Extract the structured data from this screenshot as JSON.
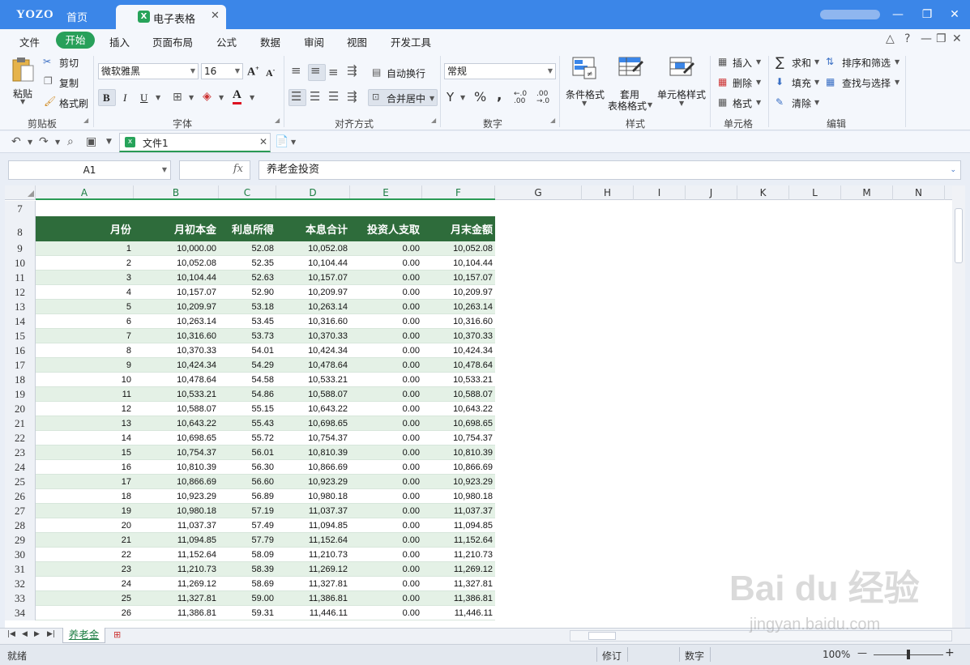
{
  "titlebar": {
    "brand": "YOZO",
    "home_tab": "首页",
    "doc_tab": "电子表格",
    "doc_tab_close": "✕",
    "minimize": "—",
    "restore": "❐",
    "close": "✕"
  },
  "menu": {
    "items": [
      "文件",
      "开始",
      "插入",
      "页面布局",
      "公式",
      "数据",
      "审阅",
      "视图",
      "开发工具"
    ],
    "active": "开始"
  },
  "ribbon": {
    "clipboard": {
      "paste": "粘贴",
      "cut": "剪切",
      "copy": "复制",
      "format_painter": "格式刷",
      "group": "剪贴板"
    },
    "font": {
      "name": "微软雅黑",
      "size": "16",
      "bold": "B",
      "italic": "I",
      "underline": "U",
      "group": "字体"
    },
    "align": {
      "wrap": "自动换行",
      "merge": "合并居中",
      "group": "对齐方式"
    },
    "number": {
      "format": "常规",
      "currency": "Y",
      "percent": "%",
      "comma": ",",
      "group": "数字"
    },
    "styles": {
      "cond": "条件格式",
      "table_1": "套用",
      "table_2": "表格格式",
      "cell_style": "单元格样式",
      "group": "样式"
    },
    "cells": {
      "insert": "插入",
      "delete": "删除",
      "format": "格式",
      "group": "单元格"
    },
    "edit": {
      "sum": "求和",
      "sort": "排序和筛选",
      "fill": "填充",
      "find": "查找与选择",
      "clear": "清除",
      "group": "编辑"
    }
  },
  "quickbar": {
    "file_tab": "文件1"
  },
  "formula_bar": {
    "name_box": "A1",
    "fx": "fx",
    "content": "养老金投资"
  },
  "columns": [
    "A",
    "B",
    "C",
    "D",
    "E",
    "F",
    "G",
    "H",
    "I",
    "J",
    "K",
    "L",
    "M",
    "N"
  ],
  "table": {
    "headers": [
      "月份",
      "月初本金",
      "利息所得",
      "本息合计",
      "投资人支取",
      "月末金额"
    ],
    "header_row": "8",
    "blank_row": "7",
    "rows": [
      [
        "9",
        "1",
        "10,000.00",
        "52.08",
        "10,052.08",
        "0.00",
        "10,052.08"
      ],
      [
        "10",
        "2",
        "10,052.08",
        "52.35",
        "10,104.44",
        "0.00",
        "10,104.44"
      ],
      [
        "11",
        "3",
        "10,104.44",
        "52.63",
        "10,157.07",
        "0.00",
        "10,157.07"
      ],
      [
        "12",
        "4",
        "10,157.07",
        "52.90",
        "10,209.97",
        "0.00",
        "10,209.97"
      ],
      [
        "13",
        "5",
        "10,209.97",
        "53.18",
        "10,263.14",
        "0.00",
        "10,263.14"
      ],
      [
        "14",
        "6",
        "10,263.14",
        "53.45",
        "10,316.60",
        "0.00",
        "10,316.60"
      ],
      [
        "15",
        "7",
        "10,316.60",
        "53.73",
        "10,370.33",
        "0.00",
        "10,370.33"
      ],
      [
        "16",
        "8",
        "10,370.33",
        "54.01",
        "10,424.34",
        "0.00",
        "10,424.34"
      ],
      [
        "17",
        "9",
        "10,424.34",
        "54.29",
        "10,478.64",
        "0.00",
        "10,478.64"
      ],
      [
        "18",
        "10",
        "10,478.64",
        "54.58",
        "10,533.21",
        "0.00",
        "10,533.21"
      ],
      [
        "19",
        "11",
        "10,533.21",
        "54.86",
        "10,588.07",
        "0.00",
        "10,588.07"
      ],
      [
        "20",
        "12",
        "10,588.07",
        "55.15",
        "10,643.22",
        "0.00",
        "10,643.22"
      ],
      [
        "21",
        "13",
        "10,643.22",
        "55.43",
        "10,698.65",
        "0.00",
        "10,698.65"
      ],
      [
        "22",
        "14",
        "10,698.65",
        "55.72",
        "10,754.37",
        "0.00",
        "10,754.37"
      ],
      [
        "23",
        "15",
        "10,754.37",
        "56.01",
        "10,810.39",
        "0.00",
        "10,810.39"
      ],
      [
        "24",
        "16",
        "10,810.39",
        "56.30",
        "10,866.69",
        "0.00",
        "10,866.69"
      ],
      [
        "25",
        "17",
        "10,866.69",
        "56.60",
        "10,923.29",
        "0.00",
        "10,923.29"
      ],
      [
        "26",
        "18",
        "10,923.29",
        "56.89",
        "10,980.18",
        "0.00",
        "10,980.18"
      ],
      [
        "27",
        "19",
        "10,980.18",
        "57.19",
        "11,037.37",
        "0.00",
        "11,037.37"
      ],
      [
        "28",
        "20",
        "11,037.37",
        "57.49",
        "11,094.85",
        "0.00",
        "11,094.85"
      ],
      [
        "29",
        "21",
        "11,094.85",
        "57.79",
        "11,152.64",
        "0.00",
        "11,152.64"
      ],
      [
        "30",
        "22",
        "11,152.64",
        "58.09",
        "11,210.73",
        "0.00",
        "11,210.73"
      ],
      [
        "31",
        "23",
        "11,210.73",
        "58.39",
        "11,269.12",
        "0.00",
        "11,269.12"
      ],
      [
        "32",
        "24",
        "11,269.12",
        "58.69",
        "11,327.81",
        "0.00",
        "11,327.81"
      ],
      [
        "33",
        "25",
        "11,327.81",
        "59.00",
        "11,386.81",
        "0.00",
        "11,386.81"
      ],
      [
        "34",
        "26",
        "11,386.81",
        "59.31",
        "11,446.11",
        "0.00",
        "11,446.11"
      ]
    ]
  },
  "sheet_tabs": {
    "active": "养老金"
  },
  "status": {
    "ready": "就绪",
    "revise": "修订",
    "numlock": "数字",
    "zoom": "100%",
    "zoom_minus": "—",
    "zoom_plus": "+"
  },
  "watermark": {
    "logo": "Bai du 经验",
    "url": "jingyan.baidu.com"
  },
  "colors": {
    "accent": "#3b86e8",
    "brand_green": "#28a05a",
    "header_band": "#2e6c3b",
    "alt_row": "#e4f1e6"
  }
}
